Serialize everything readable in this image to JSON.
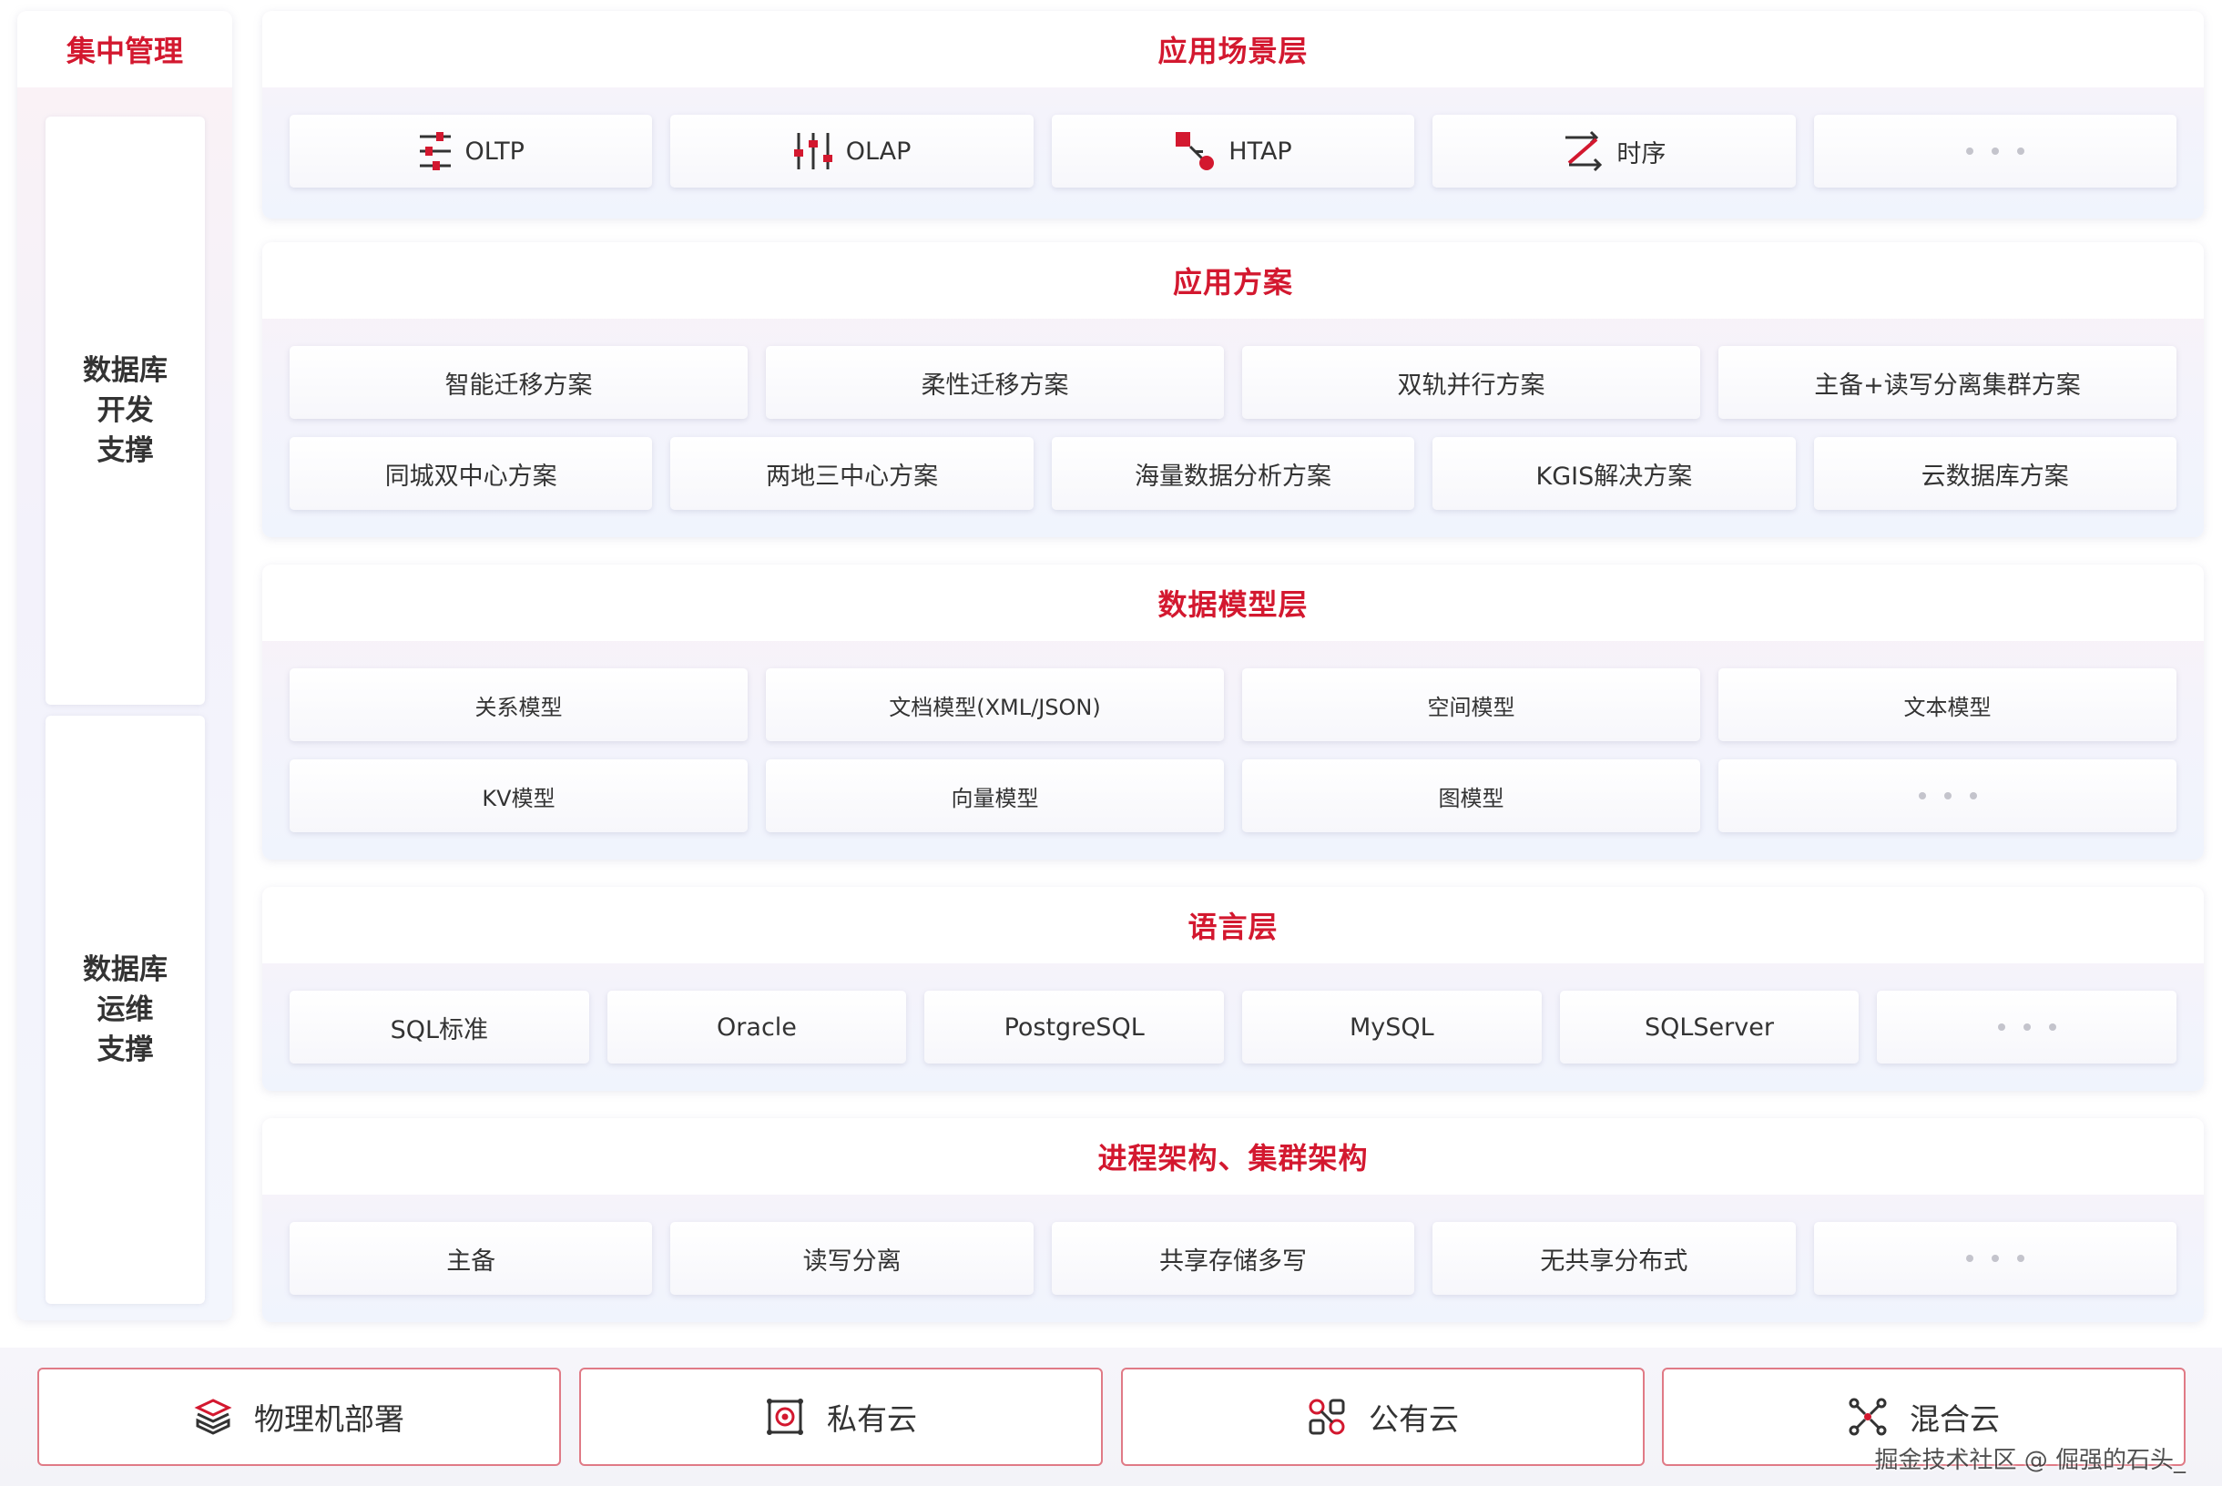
{
  "left": {
    "title": "集中管理",
    "dev_support": [
      "数据库",
      "开发",
      "支撑"
    ],
    "ops_support": [
      "数据库",
      "运维",
      "支撑"
    ]
  },
  "layers": [
    {
      "title": "应用场景层",
      "rows": [
        [
          {
            "label": "OLTP",
            "icon": "sliders-icon"
          },
          {
            "label": "OLAP",
            "icon": "equalizer-icon"
          },
          {
            "label": "HTAP",
            "icon": "htap-icon"
          },
          {
            "label": "时序",
            "icon": "timeseries-icon"
          },
          {
            "label": "",
            "dots": true
          }
        ]
      ]
    },
    {
      "title": "应用方案",
      "rows": [
        [
          {
            "label": "智能迁移方案"
          },
          {
            "label": "柔性迁移方案"
          },
          {
            "label": "双轨并行方案"
          },
          {
            "label": "主备+读写分离集群方案"
          }
        ],
        [
          {
            "label": "同城双中心方案"
          },
          {
            "label": "两地三中心方案"
          },
          {
            "label": "海量数据分析方案"
          },
          {
            "label": "KGIS解决方案"
          },
          {
            "label": "云数据库方案"
          }
        ]
      ]
    },
    {
      "title": "数据模型层",
      "rows": [
        [
          {
            "label": "关系模型"
          },
          {
            "label": "文档模型(XML/JSON)"
          },
          {
            "label": "空间模型"
          },
          {
            "label": "文本模型"
          }
        ],
        [
          {
            "label": "KV模型"
          },
          {
            "label": "向量模型"
          },
          {
            "label": "图模型"
          },
          {
            "label": "",
            "dots": true
          }
        ]
      ]
    },
    {
      "title": "语言层",
      "rows": [
        [
          {
            "label": "SQL标准"
          },
          {
            "label": "Oracle"
          },
          {
            "label": "PostgreSQL"
          },
          {
            "label": "MySQL"
          },
          {
            "label": "SQLServer"
          },
          {
            "label": "",
            "dots": true
          }
        ]
      ]
    },
    {
      "title": "进程架构、集群架构",
      "rows": [
        [
          {
            "label": "主备"
          },
          {
            "label": "读写分离"
          },
          {
            "label": "共享存储多写"
          },
          {
            "label": "无共享分布式"
          },
          {
            "label": "",
            "dots": true
          }
        ]
      ]
    }
  ],
  "deployment": [
    {
      "label": "物理机部署",
      "icon": "cube-stack-icon"
    },
    {
      "label": "私有云",
      "icon": "private-cloud-icon"
    },
    {
      "label": "公有云",
      "icon": "public-cloud-icon"
    },
    {
      "label": "混合云",
      "icon": "hybrid-cloud-icon"
    }
  ],
  "watermark": "掘金技术社区 @ 倔强的石头_",
  "colors": {
    "accent": "#d3182f",
    "border": "#e07a86"
  }
}
